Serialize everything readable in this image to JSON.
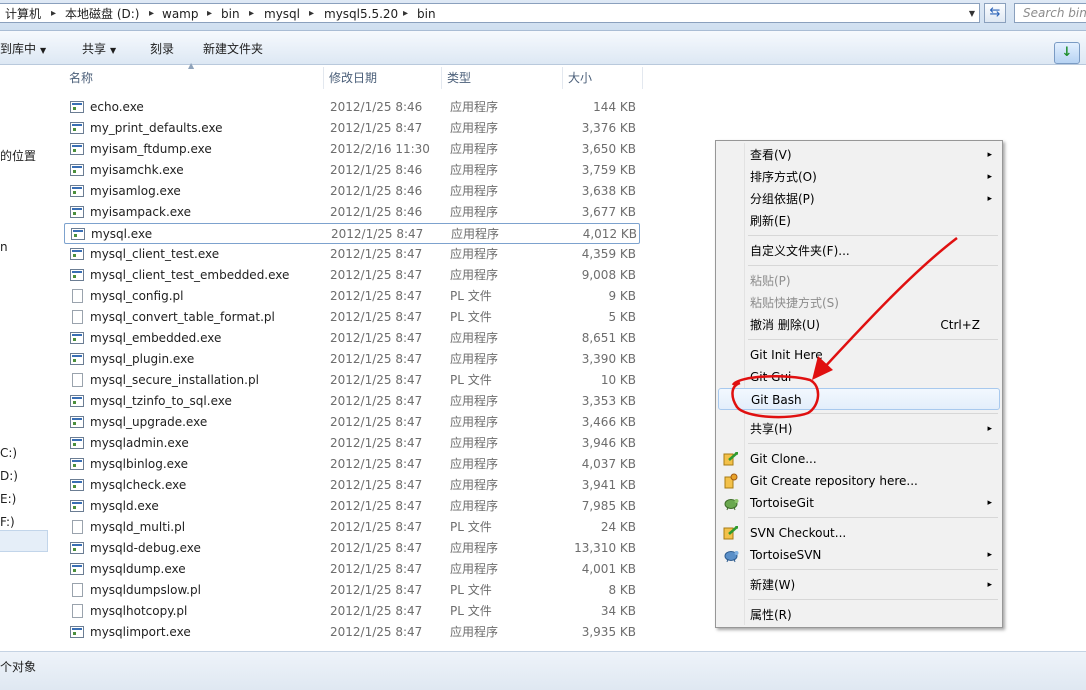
{
  "address": {
    "crumbs": [
      "计算机",
      "本地磁盘 (D:)",
      "wamp",
      "bin",
      "mysql",
      "mysql5.5.20",
      "bin"
    ],
    "search_placeholder": "Search bin"
  },
  "toolbar": {
    "include_library": "到库中",
    "share": "共享",
    "burn": "刻录",
    "new_folder": "新建文件夹"
  },
  "nav": {
    "items": [
      "的位置",
      "n",
      "C:)",
      "D:)",
      "E:)",
      "F:)"
    ]
  },
  "columns": {
    "name": "名称",
    "date": "修改日期",
    "type": "类型",
    "size": "大小"
  },
  "files": [
    {
      "name": "echo.exe",
      "date": "2012/1/25 8:46",
      "type": "应用程序",
      "size": "144 KB",
      "kind": "exe"
    },
    {
      "name": "my_print_defaults.exe",
      "date": "2012/1/25 8:47",
      "type": "应用程序",
      "size": "3,376 KB",
      "kind": "exe"
    },
    {
      "name": "myisam_ftdump.exe",
      "date": "2012/2/16 11:30",
      "type": "应用程序",
      "size": "3,650 KB",
      "kind": "exe"
    },
    {
      "name": "myisamchk.exe",
      "date": "2012/1/25 8:46",
      "type": "应用程序",
      "size": "3,759 KB",
      "kind": "exe"
    },
    {
      "name": "myisamlog.exe",
      "date": "2012/1/25 8:46",
      "type": "应用程序",
      "size": "3,638 KB",
      "kind": "exe"
    },
    {
      "name": "myisampack.exe",
      "date": "2012/1/25 8:46",
      "type": "应用程序",
      "size": "3,677 KB",
      "kind": "exe"
    },
    {
      "name": "mysql.exe",
      "date": "2012/1/25 8:47",
      "type": "应用程序",
      "size": "4,012 KB",
      "kind": "exe"
    },
    {
      "name": "mysql_client_test.exe",
      "date": "2012/1/25 8:47",
      "type": "应用程序",
      "size": "4,359 KB",
      "kind": "exe"
    },
    {
      "name": "mysql_client_test_embedded.exe",
      "date": "2012/1/25 8:47",
      "type": "应用程序",
      "size": "9,008 KB",
      "kind": "exe"
    },
    {
      "name": "mysql_config.pl",
      "date": "2012/1/25 8:47",
      "type": "PL 文件",
      "size": "9 KB",
      "kind": "pl"
    },
    {
      "name": "mysql_convert_table_format.pl",
      "date": "2012/1/25 8:47",
      "type": "PL 文件",
      "size": "5 KB",
      "kind": "pl"
    },
    {
      "name": "mysql_embedded.exe",
      "date": "2012/1/25 8:47",
      "type": "应用程序",
      "size": "8,651 KB",
      "kind": "exe"
    },
    {
      "name": "mysql_plugin.exe",
      "date": "2012/1/25 8:47",
      "type": "应用程序",
      "size": "3,390 KB",
      "kind": "exe"
    },
    {
      "name": "mysql_secure_installation.pl",
      "date": "2012/1/25 8:47",
      "type": "PL 文件",
      "size": "10 KB",
      "kind": "pl"
    },
    {
      "name": "mysql_tzinfo_to_sql.exe",
      "date": "2012/1/25 8:47",
      "type": "应用程序",
      "size": "3,353 KB",
      "kind": "exe"
    },
    {
      "name": "mysql_upgrade.exe",
      "date": "2012/1/25 8:47",
      "type": "应用程序",
      "size": "3,466 KB",
      "kind": "exe"
    },
    {
      "name": "mysqladmin.exe",
      "date": "2012/1/25 8:47",
      "type": "应用程序",
      "size": "3,946 KB",
      "kind": "exe"
    },
    {
      "name": "mysqlbinlog.exe",
      "date": "2012/1/25 8:47",
      "type": "应用程序",
      "size": "4,037 KB",
      "kind": "exe"
    },
    {
      "name": "mysqlcheck.exe",
      "date": "2012/1/25 8:47",
      "type": "应用程序",
      "size": "3,941 KB",
      "kind": "exe"
    },
    {
      "name": "mysqld.exe",
      "date": "2012/1/25 8:47",
      "type": "应用程序",
      "size": "7,985 KB",
      "kind": "exe"
    },
    {
      "name": "mysqld_multi.pl",
      "date": "2012/1/25 8:47",
      "type": "PL 文件",
      "size": "24 KB",
      "kind": "pl"
    },
    {
      "name": "mysqld-debug.exe",
      "date": "2012/1/25 8:47",
      "type": "应用程序",
      "size": "13,310 KB",
      "kind": "exe"
    },
    {
      "name": "mysqldump.exe",
      "date": "2012/1/25 8:47",
      "type": "应用程序",
      "size": "4,001 KB",
      "kind": "exe"
    },
    {
      "name": "mysqldumpslow.pl",
      "date": "2012/1/25 8:47",
      "type": "PL 文件",
      "size": "8 KB",
      "kind": "pl"
    },
    {
      "name": "mysqlhotcopy.pl",
      "date": "2012/1/25 8:47",
      "type": "PL 文件",
      "size": "34 KB",
      "kind": "pl"
    },
    {
      "name": "mysqlimport.exe",
      "date": "2012/1/25 8:47",
      "type": "应用程序",
      "size": "3,935 KB",
      "kind": "exe"
    }
  ],
  "selected_file": "mysql.exe",
  "context_menu": [
    {
      "label": "查看(V)",
      "arrow": "▸"
    },
    {
      "label": "排序方式(O)",
      "arrow": "▸"
    },
    {
      "label": "分组依据(P)",
      "arrow": "▸"
    },
    {
      "label": "刷新(E)"
    },
    {
      "sep": true
    },
    {
      "label": "自定义文件夹(F)..."
    },
    {
      "sep": true
    },
    {
      "label": "粘贴(P)",
      "disabled": true
    },
    {
      "label": "粘贴快捷方式(S)",
      "disabled": true
    },
    {
      "label": "撤消 删除(U)",
      "shortcut": "Ctrl+Z"
    },
    {
      "sep": true
    },
    {
      "label": "Git Init Here"
    },
    {
      "label": "Git Gui"
    },
    {
      "label": "Git Bash",
      "highlighted": true
    },
    {
      "sep": true
    },
    {
      "label": "共享(H)",
      "arrow": "▸"
    },
    {
      "sep": true
    },
    {
      "label": "Git Clone...",
      "icon": "tortoisegit-clone-icon"
    },
    {
      "label": "Git Create repository here...",
      "icon": "tortoisegit-create-repo-icon"
    },
    {
      "label": "TortoiseGit",
      "icon": "tortoisegit-icon",
      "arrow": "▸"
    },
    {
      "sep": true
    },
    {
      "label": "SVN Checkout...",
      "icon": "svn-checkout-icon"
    },
    {
      "label": "TortoiseSVN",
      "icon": "tortoisesvn-icon",
      "arrow": "▸"
    },
    {
      "sep": true
    },
    {
      "label": "新建(W)",
      "arrow": "▸"
    },
    {
      "sep": true
    },
    {
      "label": "属性(R)"
    }
  ],
  "status": {
    "text": "个对象"
  },
  "colors": {
    "annotation_red": "#e01010",
    "selection_border": "#7da2ce",
    "menu_highlight": "#a8c9ee"
  }
}
